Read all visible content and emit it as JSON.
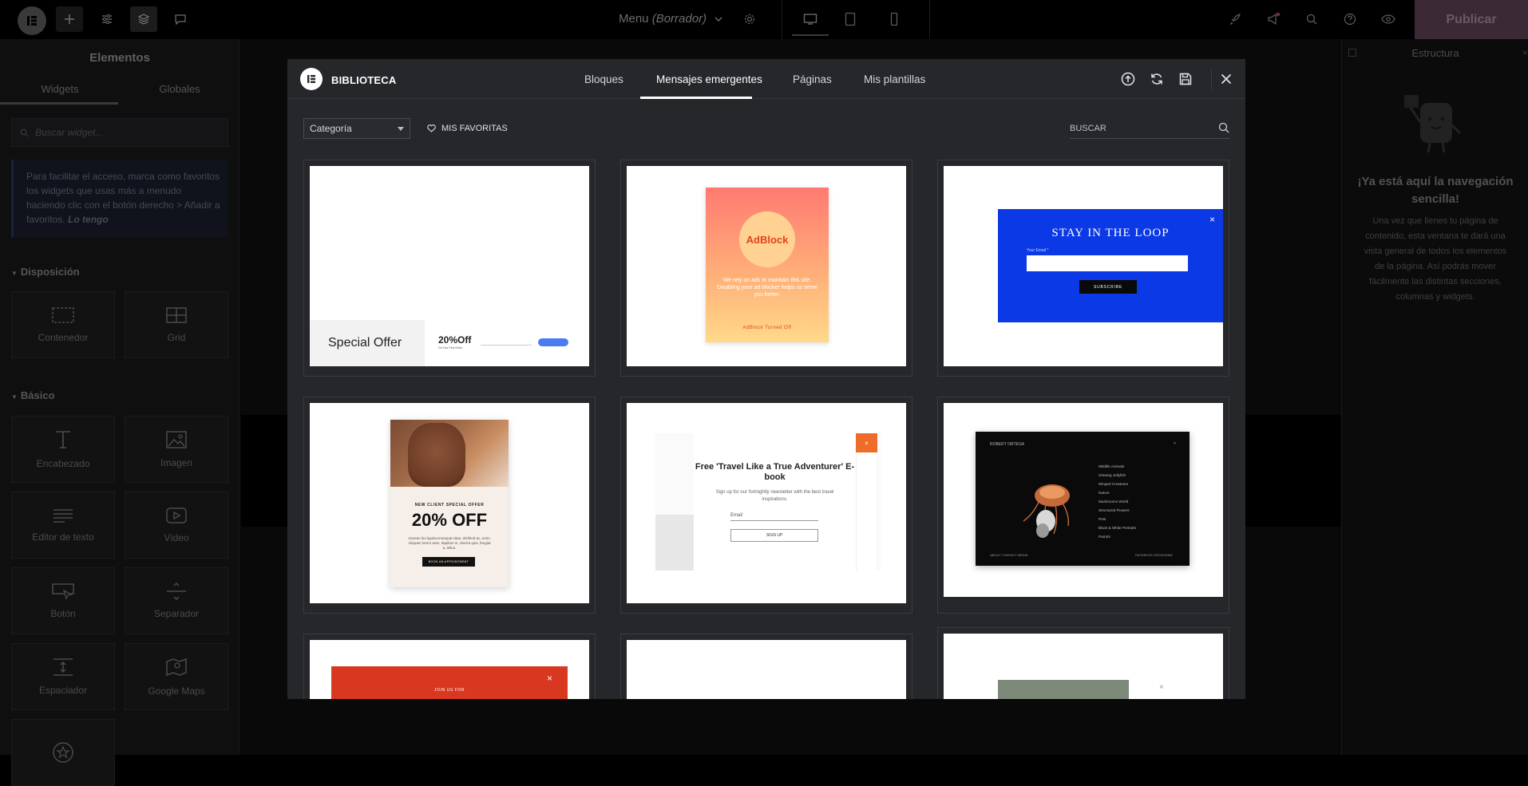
{
  "topbar": {
    "doc_title": "Menu",
    "doc_status": "(Borrador)",
    "publish_label": "Publicar"
  },
  "left_panel": {
    "title": "Elementos",
    "tabs": [
      "Widgets",
      "Globales"
    ],
    "search_placeholder": "Buscar widget...",
    "note_text": "Para facilitar el acceso, marca como favoritos los widgets que usas más a menudo haciendo clic con el botón derecho > Añadir a favoritos.",
    "note_link": "Lo tengo",
    "section_layout": "Disposición",
    "section_basic": "Básico",
    "layout_widgets": [
      "Contenedor",
      "Grid"
    ],
    "basic_widgets": [
      "Encabezado",
      "Imagen",
      "Editor de texto",
      "Vídeo",
      "Botón",
      "Separador",
      "Espaciador",
      "Google Maps"
    ]
  },
  "right_panel": {
    "title": "Estructura",
    "heading": "¡Ya está aquí la navegación sencilla!",
    "text": "Una vez que llenes tu página de contenido, esta ventana te dará una vista general de todos los elementos de la página. Así podrás mover fácilmente las distintas secciones, columnas y widgets."
  },
  "modal": {
    "title": "BIBLIOTECA",
    "tabs": [
      "Bloques",
      "Mensajes emergentes",
      "Páginas",
      "Mis plantillas"
    ],
    "active_tab": "Mensajes emergentes",
    "category_label": "Categoría",
    "favorites_label": "MIS FAVORITAS",
    "search_placeholder": "BUSCAR",
    "icons": [
      "upload-icon",
      "sync-icon",
      "save-icon",
      "close-icon"
    ]
  },
  "templates": {
    "t1": {
      "title": "Special Offer",
      "offer": "20%Off",
      "sub": "On Your First Order"
    },
    "t2": {
      "brand": "AdBlock",
      "body": "We rely on ads to maintain this site. Disabling your ad blocker helps us serve you better.",
      "footer": "AdBlock Turned Off"
    },
    "t3": {
      "title": "STAY IN THE LOOP",
      "email_label": "Your Email *",
      "button": "SUBSCRIBE"
    },
    "t4": {
      "eyebrow": "NEW CLIENT SPECIAL OFFER",
      "discount": "20% OFF",
      "body": "Aenean leo ligulaconsequat vitae, eleifend ac, enim. Aliquam lorem ante, dapibus in, viverra quis, feugiat a, tellus.",
      "button": "BOOK AN APPOINTMENT"
    },
    "t5": {
      "title": "Free 'Travel Like a True Adventurer' E-book",
      "body": "Sign up for our fortnightly newsletter with the best travel inspirations.",
      "email_label": "Email",
      "button": "SIGN UP"
    },
    "t6": {
      "brand": "ROBERT ORTEGA",
      "menu": [
        "Wildlife Animals",
        "Glowing Jellyfish",
        "Winged Creatures",
        "Nature",
        "Mushrooms World",
        "Structured Flowers",
        "Pets",
        "Black & White Portraits",
        "Parrots"
      ],
      "footer_left": "ABOUT   CONTACT   MEDIA",
      "footer_right": "FACEBOOK   INSTAGRAM"
    },
    "t7": {
      "label": "JOIN US FOR"
    }
  },
  "colors": {
    "modal_bg": "#26272b",
    "publish_bg": "#3b2a35",
    "accent_orange": "#ef6b2a",
    "loop_blue": "#0b39e6"
  }
}
